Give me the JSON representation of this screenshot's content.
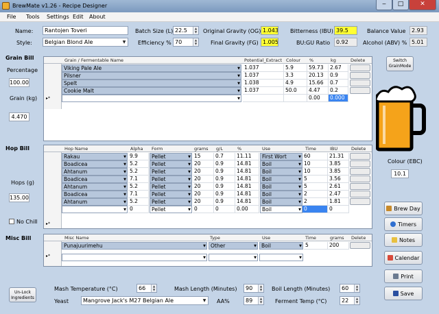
{
  "window": {
    "title": "BrewMate v1.26 - Recipe Designer",
    "min": "‒",
    "max": "□",
    "close": "✕"
  },
  "menu": [
    "File",
    "Tools",
    "Settings",
    "Edit",
    "About"
  ],
  "recipe": {
    "name_label": "Name:",
    "name": "Rantojen Toveri",
    "style_label": "Style:",
    "style": "Belgian Blond Ale",
    "batch_label": "Batch Size (L)",
    "batch": "22.5",
    "eff_label": "Efficiency %",
    "eff": "70",
    "og_label": "Original Gravity (OG)",
    "og": "1.043",
    "fg_label": "Final Gravity (FG)",
    "fg": "1.005",
    "ibu_label": "Bitterness (IBU)",
    "ibu": "39.5",
    "bugu_label": "BU:GU Ratio",
    "bugu": "0.92",
    "balance_label": "Balance Value",
    "balance": "2.93",
    "abv_label": "Alcohol (ABV) %",
    "abv": "5.01"
  },
  "grain": {
    "section": "Grain Bill",
    "pct_label": "Percentage",
    "pct": "100.00",
    "kg_label": "Grain (kg)",
    "kg": "4.470",
    "headers": [
      "Grain / Fermentable Name",
      "Potential_Extract",
      "Colour",
      "%",
      "kg",
      "Delete"
    ],
    "rows": [
      [
        "Viking Pale Ale",
        "1.037",
        "5.9",
        "59.73",
        "2.67"
      ],
      [
        "Pilsner",
        "1.037",
        "3.3",
        "20.13",
        "0.9"
      ],
      [
        "Spelt",
        "1.038",
        "4.9",
        "15.66",
        "0.7"
      ],
      [
        "Cookie Malt",
        "1.037",
        "50.0",
        "4.47",
        "0.2"
      ]
    ],
    "new_row": [
      "",
      "",
      "",
      "0.00",
      "0.000"
    ],
    "switch_btn": "Switch GrainMode"
  },
  "colour": {
    "label": "Colour (EBC)",
    "value": "10.1"
  },
  "hops": {
    "section": "Hop Bill",
    "g_label": "Hops (g)",
    "g": "135.00",
    "nochill": "No Chill",
    "headers": [
      "Hop Name",
      "Alpha",
      "Form",
      "grams",
      "g/L",
      "%",
      "Use",
      "Time",
      "IBU",
      "Delete"
    ],
    "rows": [
      [
        "Rakau",
        "9.9",
        "Pellet",
        "15",
        "0.7",
        "11.11",
        "First Wort",
        "60",
        "21.31"
      ],
      [
        "Boadicea",
        "5.2",
        "Pellet",
        "20",
        "0.9",
        "14.81",
        "Boil",
        "10",
        "3.85"
      ],
      [
        "Ahtanum",
        "5.2",
        "Pellet",
        "20",
        "0.9",
        "14.81",
        "Boil",
        "10",
        "3.85"
      ],
      [
        "Boadicea",
        "7.1",
        "Pellet",
        "20",
        "0.9",
        "14.81",
        "Boil",
        "5",
        "3.56"
      ],
      [
        "Ahtanum",
        "5.2",
        "Pellet",
        "20",
        "0.9",
        "14.81",
        "Boil",
        "5",
        "2.61"
      ],
      [
        "Boadicea",
        "7.1",
        "Pellet",
        "20",
        "0.9",
        "14.81",
        "Boil",
        "2",
        "2.47"
      ],
      [
        "Ahtanum",
        "5.2",
        "Pellet",
        "20",
        "0.9",
        "14.81",
        "Boil",
        "2",
        "1.81"
      ]
    ],
    "new_row": [
      "",
      "0",
      "Pellet",
      "0",
      "0",
      "0.00",
      "Boil",
      "0",
      "0"
    ]
  },
  "misc": {
    "section": "Misc Bill",
    "headers": [
      "Misc Name",
      "Type",
      "Use",
      "Time",
      "grams",
      "Delete"
    ],
    "rows": [
      [
        "Punajuurimehu",
        "Other",
        "Boil",
        "5",
        "200"
      ]
    ]
  },
  "buttons": {
    "brew_day": "Brew Day",
    "timers": "Timers",
    "notes": "Notes",
    "calendar": "Calendar",
    "print": "Print",
    "save": "Save",
    "unlock": "Un-Lock Ingredients"
  },
  "bottom": {
    "mash_temp_label": "Mash Temperature (°C)",
    "mash_temp": "66",
    "mash_len_label": "Mash Length (Minutes)",
    "mash_len": "90",
    "boil_len_label": "Boil Length (Minutes)",
    "boil_len": "60",
    "yeast_label": "Yeast",
    "yeast": "Mangrove Jack's M27 Belgian Ale",
    "aa_label": "AA%",
    "aa": "89",
    "ferment_label": "Ferment Temp (°C)",
    "ferment": "22"
  }
}
